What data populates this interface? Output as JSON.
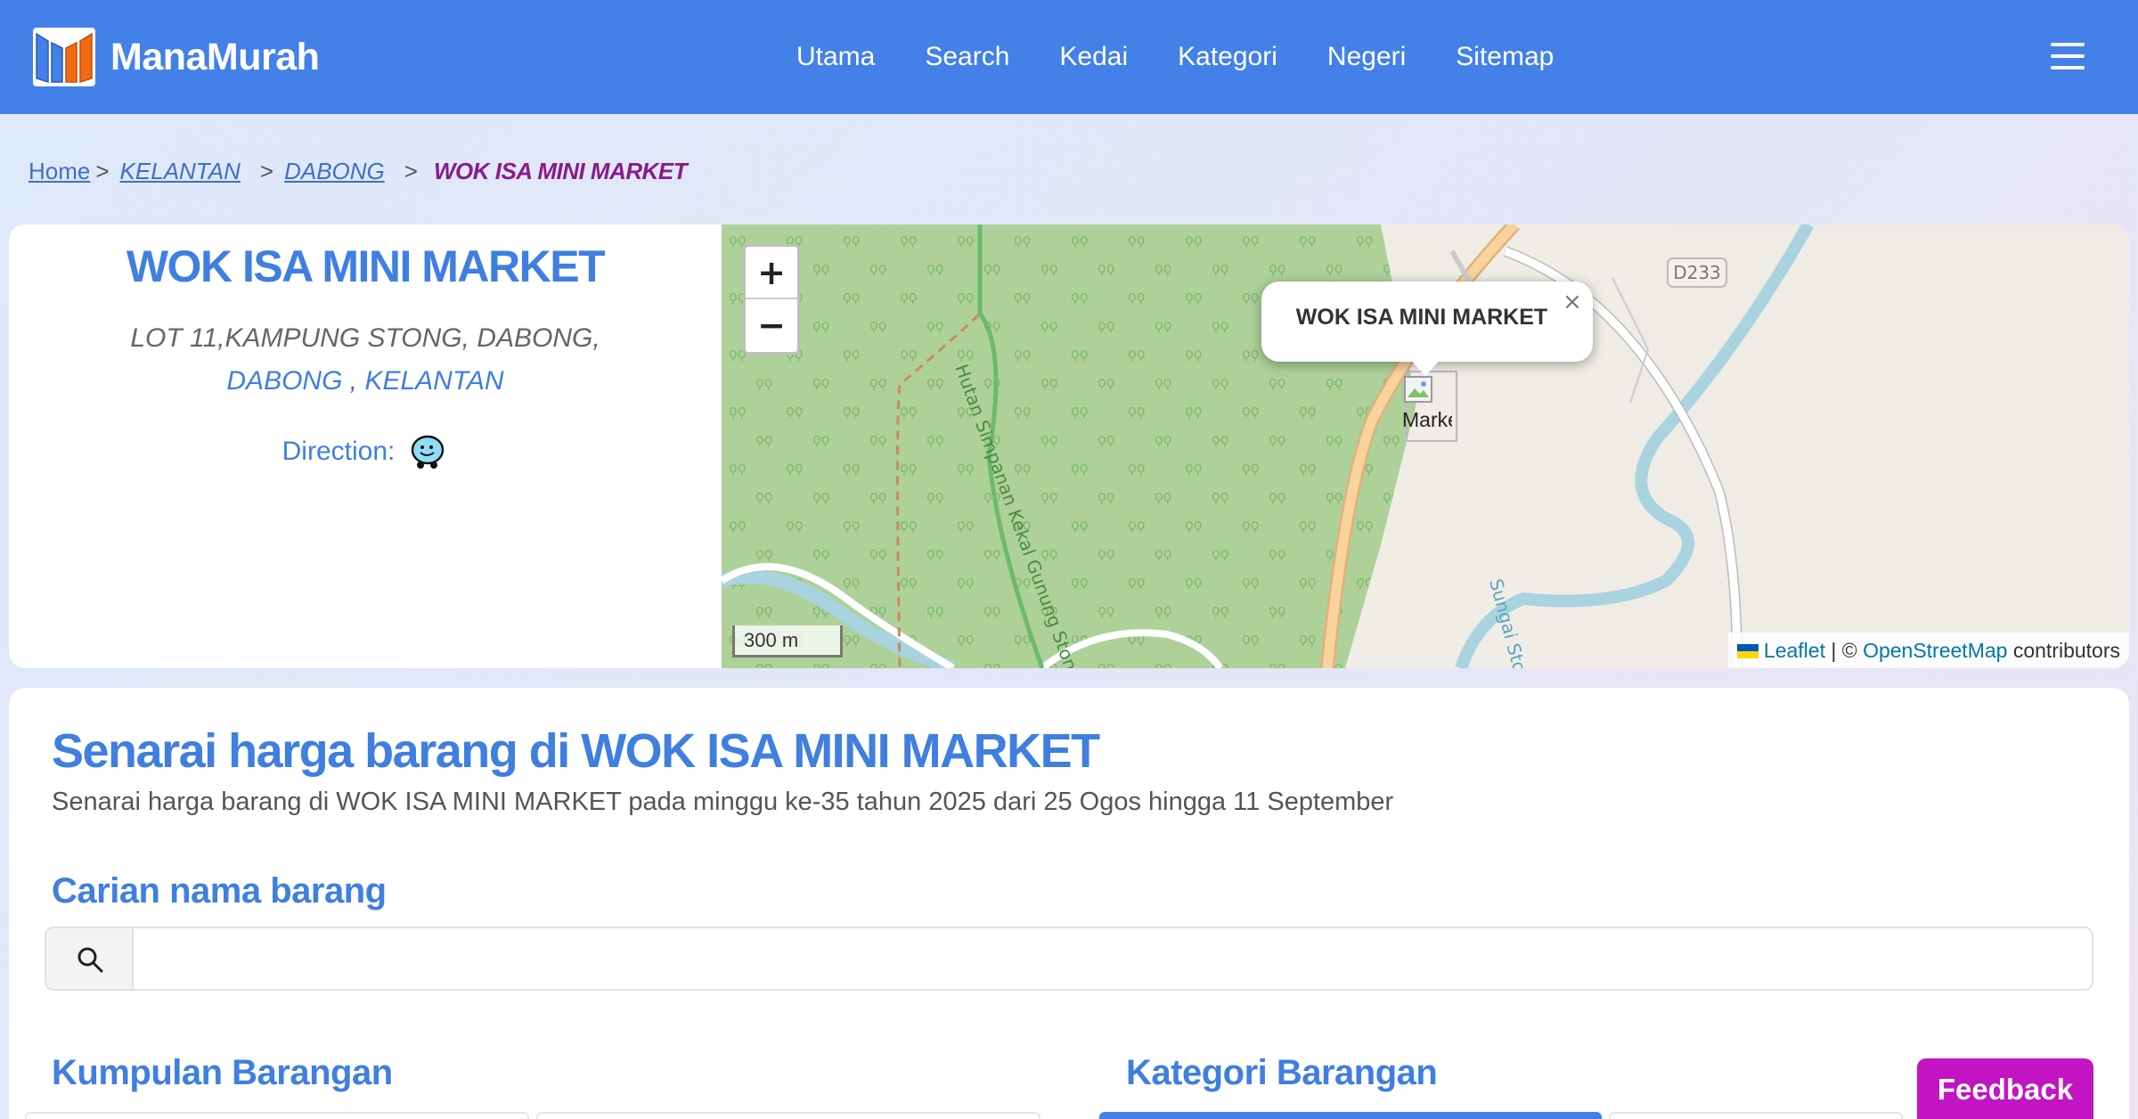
{
  "navbar": {
    "brand": "ManaMurah",
    "links": [
      "Utama",
      "Search",
      "Kedai",
      "Kategori",
      "Negeri",
      "Sitemap"
    ],
    "bg_color": "#4380e8"
  },
  "breadcrumb": {
    "home": "Home",
    "state": "KELANTAN",
    "district": "DABONG",
    "current": "WOK ISA MINI MARKET",
    "separator": ">"
  },
  "shop": {
    "name": "WOK ISA MINI MARKET",
    "address_line": "LOT 11,KAMPUNG STONG, DABONG,",
    "district": "DABONG",
    "state": "KELANTAN",
    "direction_label": "Direction:",
    "direction_icon": "waze-icon"
  },
  "map": {
    "zoom_in": "+",
    "zoom_out": "−",
    "popup_text": "WOK ISA MINI MARKET",
    "popup_close": "×",
    "marker_alt": "Marker",
    "scale": "300 m",
    "attribution": {
      "leaflet": "Leaflet",
      "sep": " | © ",
      "osm": "OpenStreetMap",
      "suffix": " contributors"
    },
    "labels": {
      "road": "D233",
      "trail": "Hutan Simpanan Kekal Gunung Stong Tengah",
      "river": "Sungai Stong"
    }
  },
  "listing": {
    "title": "Senarai harga barang di WOK ISA MINI MARKET",
    "subtitle": "Senarai harga barang di WOK ISA MINI MARKET pada minggu ke-35 tahun 2025 dari 25 Ogos hingga 11 September",
    "search_label": "Carian nama barang",
    "search_placeholder": "",
    "search_value": "",
    "groups_title": "Kumpulan Barangan",
    "categories_title": "Kategori Barangan"
  },
  "feedback": {
    "label": "Feedback",
    "color": "#c214c2"
  }
}
